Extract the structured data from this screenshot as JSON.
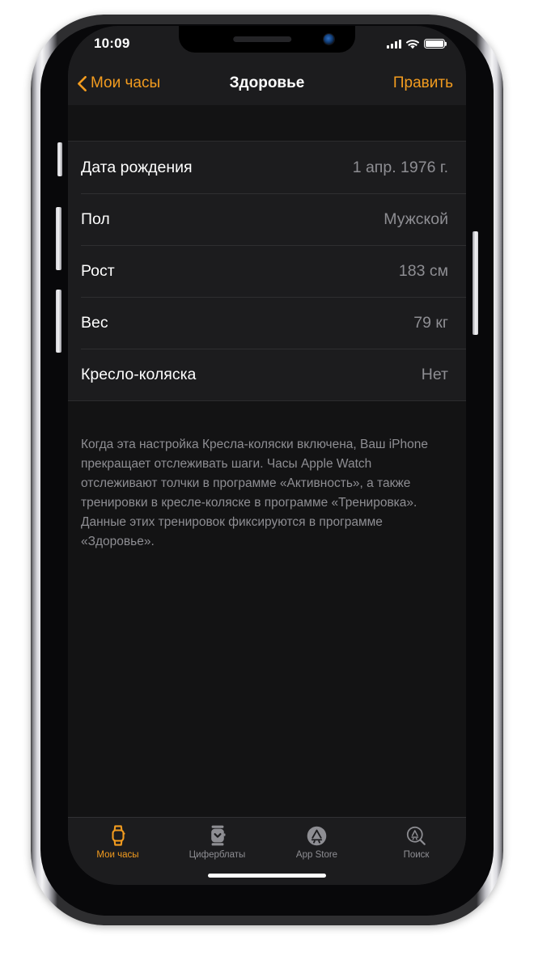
{
  "status_bar": {
    "time": "10:09",
    "signal_icon": "cellular-bars-icon",
    "wifi_icon": "wifi-icon",
    "battery_icon": "battery-full-icon"
  },
  "nav_bar": {
    "back_label": "Мои часы",
    "back_icon": "chevron-left-icon",
    "title": "Здоровье",
    "edit_label": "Править"
  },
  "settings_rows": [
    {
      "label": "Дата рождения",
      "value": "1 апр. 1976 г."
    },
    {
      "label": "Пол",
      "value": "Мужской"
    },
    {
      "label": "Рост",
      "value": "183 см"
    },
    {
      "label": "Вес",
      "value": "79 кг"
    },
    {
      "label": "Кресло-коляска",
      "value": "Нет"
    }
  ],
  "footnote": "Когда эта настройка Кресла-коляски включена, Ваш iPhone прекращает отслеживать шаги. Часы Apple Watch отслеживают толчки в программе «Активность», а также тренировки в кресле-коляске в программе «Тренировка». Данные этих тренировок фиксируются в программе «Здоровье».",
  "tab_bar": [
    {
      "label": "Мои часы",
      "icon": "watch-outline-icon",
      "active": true
    },
    {
      "label": "Циферблаты",
      "icon": "watch-face-icon",
      "active": false
    },
    {
      "label": "App Store",
      "icon": "app-store-icon",
      "active": false
    },
    {
      "label": "Поиск",
      "icon": "app-store-search-icon",
      "active": false
    }
  ],
  "colors": {
    "accent": "#f39c1f",
    "screen_bg": "#1c1c1e",
    "content_bg": "#131314",
    "secondary_text": "#8e8e93"
  }
}
